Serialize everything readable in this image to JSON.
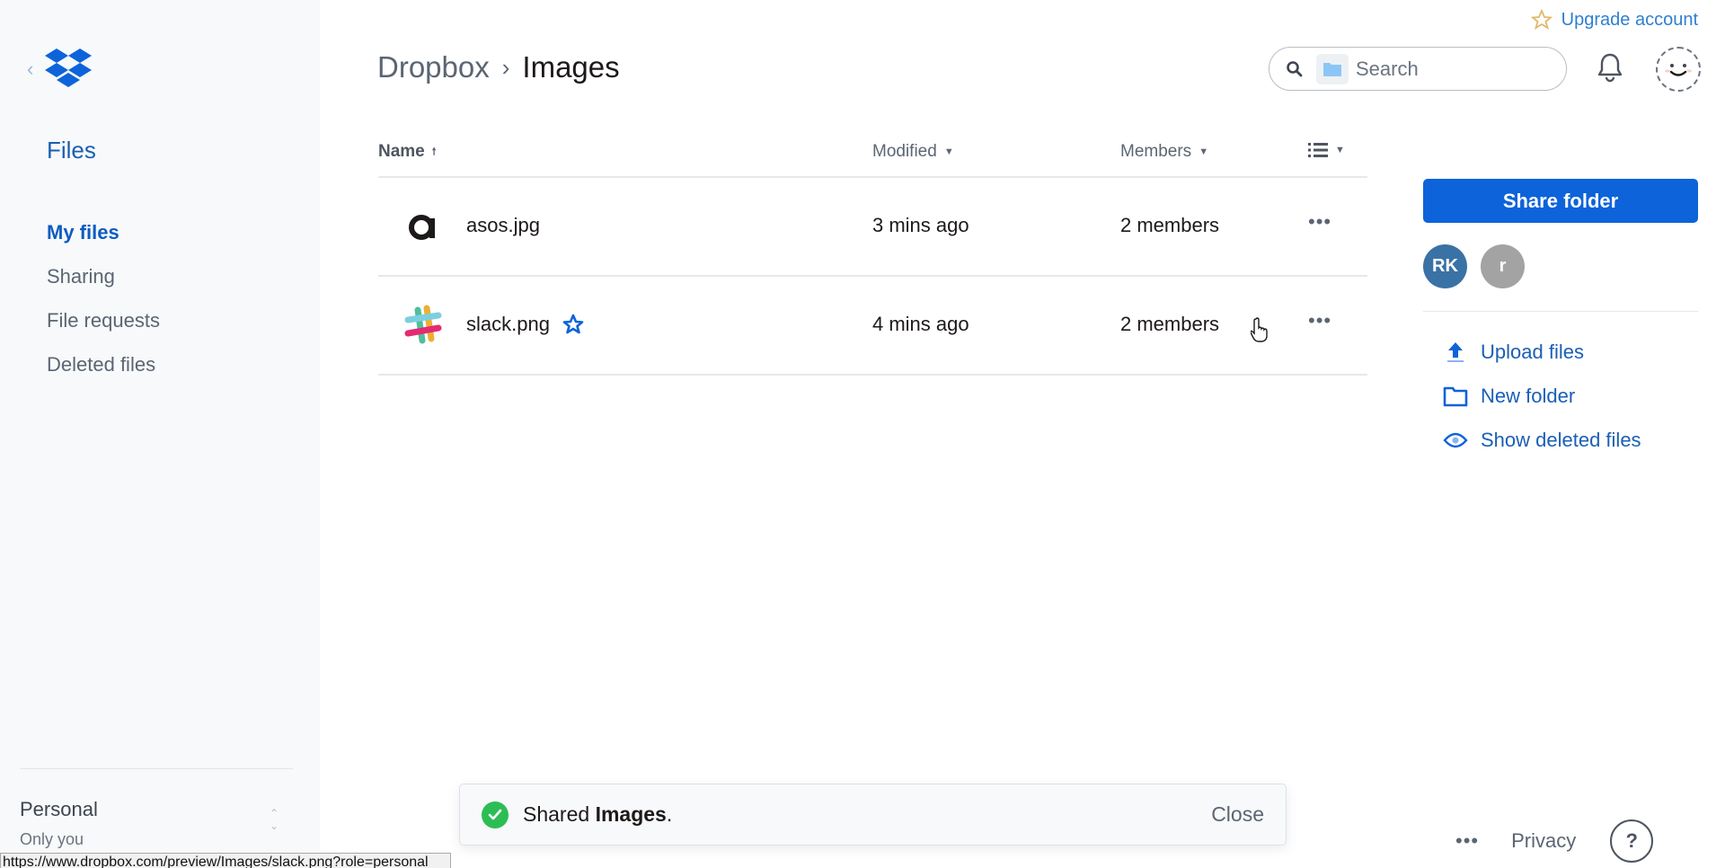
{
  "sidebar": {
    "title": "Files",
    "items": [
      {
        "label": "My files",
        "active": true
      },
      {
        "label": "Sharing"
      },
      {
        "label": "File requests"
      },
      {
        "label": "Deleted files"
      }
    ],
    "account": {
      "name": "Personal",
      "sub": "Only you"
    }
  },
  "header": {
    "upgrade_label": "Upgrade account",
    "breadcrumb": {
      "root": "Dropbox",
      "current": "Images"
    },
    "search_placeholder": "Search"
  },
  "table": {
    "columns": {
      "name": "Name",
      "modified": "Modified",
      "members": "Members"
    },
    "rows": [
      {
        "name": "asos.jpg",
        "modified": "3 mins ago",
        "members": "2 members",
        "starred": false,
        "thumb": "asos-logo"
      },
      {
        "name": "slack.png",
        "modified": "4 mins ago",
        "members": "2 members",
        "starred": true,
        "thumb": "slack-logo"
      }
    ]
  },
  "right_panel": {
    "share_label": "Share folder",
    "members": [
      {
        "initials": "RK",
        "color": "#3a72a6"
      },
      {
        "initials": "r",
        "color": "#a3a3a3"
      }
    ],
    "actions": [
      {
        "label": "Upload files",
        "icon": "upload-icon"
      },
      {
        "label": "New folder",
        "icon": "folder-icon"
      },
      {
        "label": "Show deleted files",
        "icon": "eye-icon"
      }
    ]
  },
  "toast": {
    "prefix": "Shared ",
    "bold": "Images",
    "suffix": ".",
    "close_label": "Close"
  },
  "footer": {
    "more": "•••",
    "privacy": "Privacy",
    "help": "?"
  },
  "statusbar": {
    "url": "https://www.dropbox.com/preview/Images/slack.png?role=personal"
  },
  "colors": {
    "accent": "#0d63d9",
    "link": "#1a5fb4",
    "success": "#2dbd55"
  }
}
